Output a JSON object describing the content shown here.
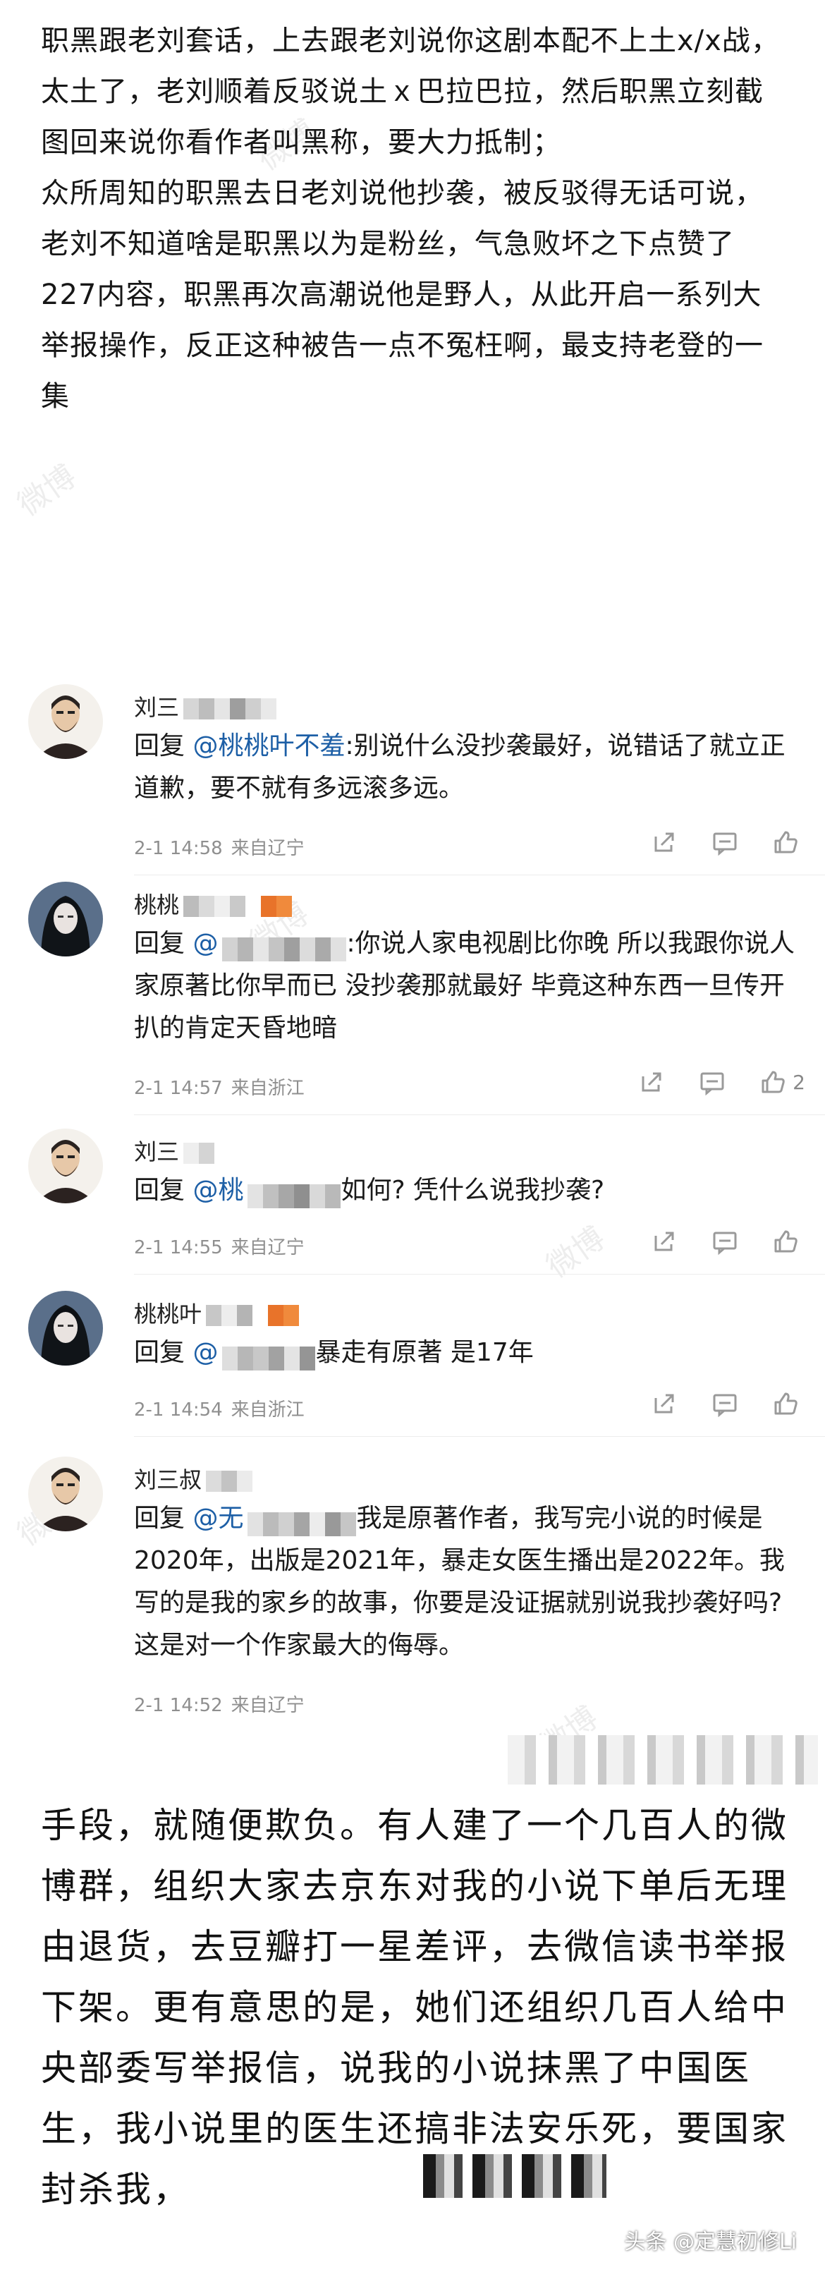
{
  "top_paragraphs": [
    "职黑跟老刘套话，上去跟老刘说你这剧本配不上土x/x战，太土了，老刘顺着反驳说土ｘ巴拉巴拉，然后职黑立刻截图回来说你看作者叫黑称，要大力抵制；",
    "众所周知的职黑去日老刘说他抄袭，被反驳得无话可说，老刘不知道啥是职黑以为是粉丝，气急败坏之下点赞了227内容，职黑再次高潮说他是野人，从此开启一系列大举报操作，反正这种被告一点不冤枉啊，最支持老登的一集"
  ],
  "comments": [
    {
      "name": "刘三",
      "reply_prefix": "回复",
      "mention": "@桃桃叶不羞",
      "text": ":别说什么没抄袭最好，说错话了就立正道歉，要不就有多远滚多远。",
      "time": "2-1 14:58",
      "location": "来自辽宁",
      "likes": ""
    },
    {
      "name": "桃桃",
      "reply_prefix": "回复",
      "mention": "@",
      "text": ":你说人家电视剧比你晚 所以我跟你说人家原著比你早而已 没抄袭那就最好 毕竟这种东西一旦传开扒的肯定天昏地暗",
      "time": "2-1 14:57",
      "location": "来自浙江",
      "likes": "2"
    },
    {
      "name": "刘三",
      "reply_prefix": "回复",
      "mention": "@桃",
      "text": "如何? 凭什么说我抄袭?",
      "time": "2-1 14:55",
      "location": "来自辽宁",
      "likes": ""
    },
    {
      "name": "桃桃叶",
      "reply_prefix": "回复",
      "mention": "@",
      "text": "暴走有原著 是17年",
      "time": "2-1 14:54",
      "location": "来自浙江",
      "likes": ""
    },
    {
      "name": "刘三叔",
      "reply_prefix": "回复",
      "mention": "@无",
      "text": "我是原著作者，我写完小说的时候是2020年，出版是2021年，暴走女医生播出是2022年。我写的是我的家乡的故事，你要是没证据就别说我抄袭好吗? 这是对一个作家最大的侮辱。",
      "time": "2-1 14:52",
      "location": "来自辽宁",
      "likes": ""
    }
  ],
  "bottom_paragraph": "手段，就随便欺负。有人建了一个几百人的微博群，组织大家去京东对我的小说下单后无理由退货，去豆瓣打一星差评，去微信读书举报下架。更有意思的是，她们还组织几百人给中央部委写举报信，说我的小说抹黑了中国医生，我小说里的医生还搞非法安乐死，要国家封杀我，",
  "footer_watermark": "头条 @定慧初修Li",
  "weibo_watermark": "微博",
  "icons": [
    "share-icon",
    "comment-icon",
    "like-icon",
    "avatar-beard-icon",
    "avatar-longhair-icon"
  ]
}
